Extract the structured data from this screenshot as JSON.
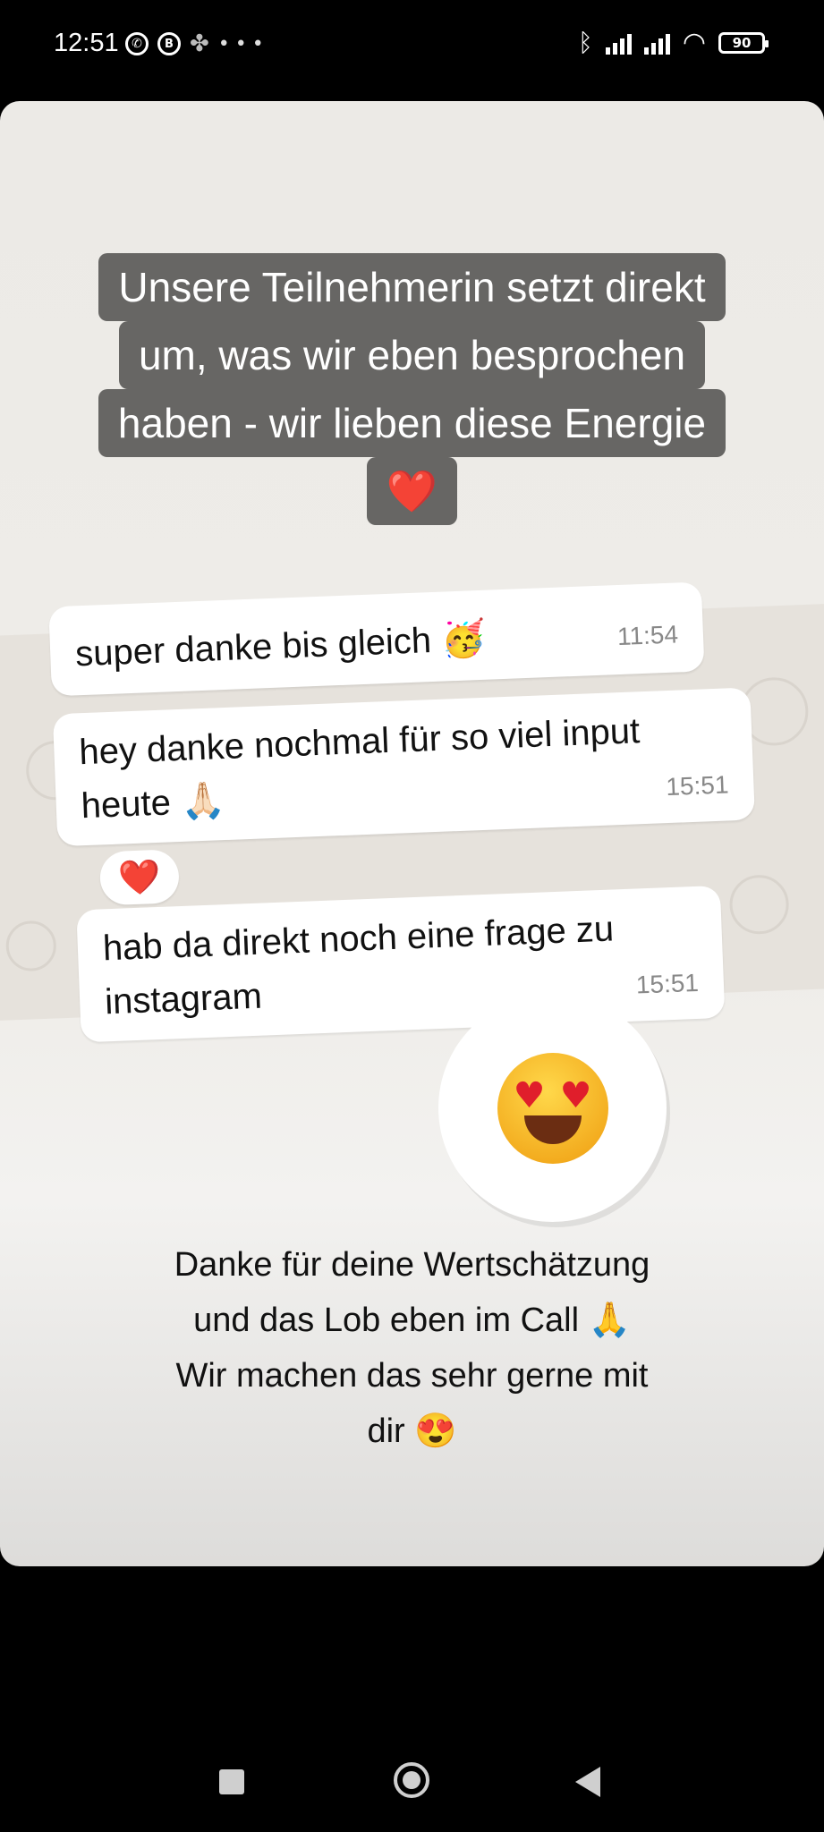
{
  "status_bar": {
    "time": "12:51",
    "battery": "90"
  },
  "story": {
    "caption_lines": [
      "Unsere Teilnehmerin setzt direkt",
      "um, was wir eben besprochen",
      "haben - wir lieben diese Energie",
      "❤️"
    ],
    "chat": {
      "messages": [
        {
          "text": "super danke bis gleich 🥳",
          "time": "11:54"
        },
        {
          "line1": "hey danke nochmal für so viel input",
          "line2": "heute 🙏🏻",
          "time": "15:51",
          "reaction": "❤️"
        },
        {
          "line1": "hab da direkt noch eine frage zu",
          "line2": "instagram",
          "time": "15:51"
        }
      ]
    },
    "sticker_icon": "heart-eyes-emoji-icon",
    "closing_lines": [
      "Danke für deine Wertschätzung",
      "und das Lob eben im Call 🙏",
      "Wir machen das sehr gerne mit",
      "dir 😍"
    ]
  },
  "nav_icons": [
    "recents-square-icon",
    "home-circle-icon",
    "back-triangle-icon"
  ]
}
